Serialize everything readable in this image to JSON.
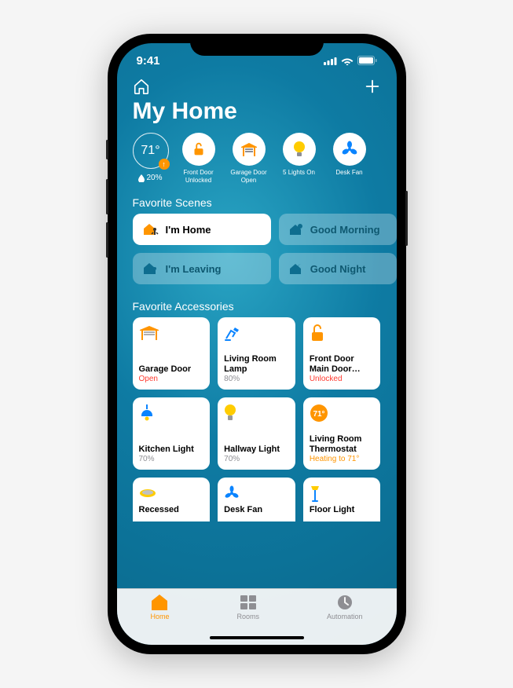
{
  "status_bar": {
    "time": "9:41"
  },
  "header": {
    "title": "My Home"
  },
  "summary": {
    "temperature": "71°",
    "humidity": "20%",
    "items": [
      {
        "label": "Front Door Unlocked",
        "icon": "lock-open"
      },
      {
        "label": "Garage Door Open",
        "icon": "garage"
      },
      {
        "label": "5 Lights On",
        "icon": "bulb"
      },
      {
        "label": "Desk Fan",
        "icon": "fan"
      }
    ]
  },
  "sections": {
    "scenes_label": "Favorite Scenes",
    "accessories_label": "Favorite Accessories"
  },
  "scenes": [
    {
      "label": "I'm Home",
      "icon": "home-arrive",
      "active": true
    },
    {
      "label": "I'm Leaving",
      "icon": "home-leave",
      "active": false
    },
    {
      "label": "Good Morning",
      "icon": "home-sun",
      "active": false
    },
    {
      "label": "Good Night",
      "icon": "home-moon",
      "active": false
    }
  ],
  "accessories": [
    {
      "name": "Garage Door",
      "state": "Open",
      "state_style": "alert",
      "icon": "garage"
    },
    {
      "name": "Living Room Lamp",
      "state": "80%",
      "state_style": "",
      "icon": "desk-lamp"
    },
    {
      "name": "Front Door Main Door…",
      "state": "Unlocked",
      "state_style": "alert",
      "icon": "lock-open"
    },
    {
      "name": "Kitchen Light",
      "state": "70%",
      "state_style": "",
      "icon": "pendant"
    },
    {
      "name": "Hallway Light",
      "state": "70%",
      "state_style": "",
      "icon": "bulb"
    },
    {
      "name": "Living Room Thermostat",
      "state": "Heating to 71°",
      "state_style": "heat",
      "icon": "thermostat"
    },
    {
      "name": "Recessed",
      "state": "",
      "state_style": "",
      "icon": "recessed"
    },
    {
      "name": "Desk Fan",
      "state": "",
      "state_style": "",
      "icon": "fan"
    },
    {
      "name": "Floor Light",
      "state": "",
      "state_style": "",
      "icon": "floor-lamp"
    }
  ],
  "tabs": [
    {
      "label": "Home",
      "active": true
    },
    {
      "label": "Rooms",
      "active": false
    },
    {
      "label": "Automation",
      "active": false
    }
  ],
  "colors": {
    "accent": "#ff9500",
    "alert": "#ff3b30",
    "blue": "#0a84ff"
  }
}
